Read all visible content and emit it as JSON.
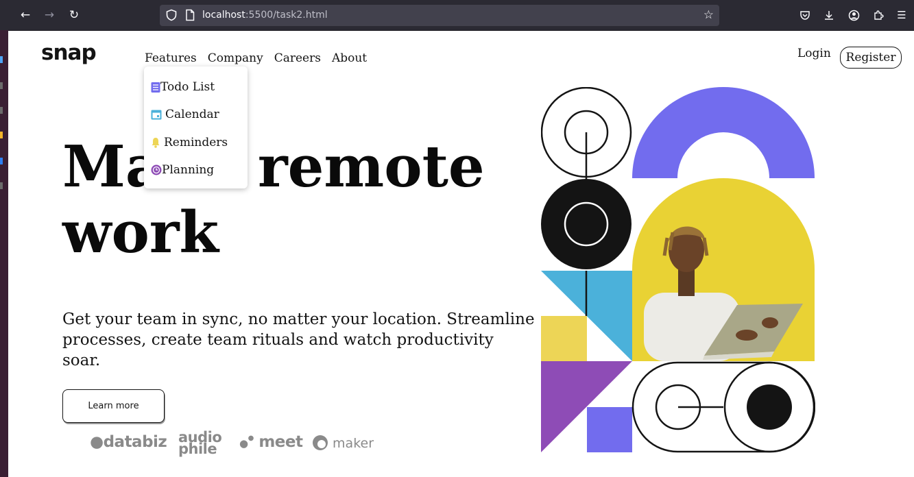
{
  "browser": {
    "url_host": "localhost",
    "url_rest": ":5500/task2.html"
  },
  "brand": {
    "logo": "snap"
  },
  "nav": {
    "items": [
      {
        "label": "Features"
      },
      {
        "label": "Company"
      },
      {
        "label": "Careers"
      },
      {
        "label": "About"
      }
    ],
    "login": "Login",
    "register": "Register"
  },
  "dropdown": {
    "items": [
      {
        "label": "Todo List",
        "icon": "todo-icon",
        "color": "#726cee"
      },
      {
        "label": "Calendar",
        "icon": "calendar-icon",
        "color": "#4bb1da"
      },
      {
        "label": "Reminders",
        "icon": "bell-icon",
        "color": "#edd556"
      },
      {
        "label": "Planning",
        "icon": "clock-icon",
        "color": "#8e4cb6"
      }
    ]
  },
  "hero": {
    "headline_line1": "Make remote",
    "headline_line2": "work",
    "subtext": "Get your team in sync, no matter your location. Streamline processes, create team rituals and watch productivity soar.",
    "cta": "Learn more"
  },
  "clients": {
    "databiz": "databiz",
    "audiophile_top": "audio",
    "audiophile_bottom": "phile",
    "meet": "meet",
    "maker": "maker"
  },
  "colors": {
    "purple": "#726cee",
    "yellow": "#edd556",
    "blue": "#4bb1da",
    "violet": "#8e4cb6",
    "dark": "#141414"
  }
}
